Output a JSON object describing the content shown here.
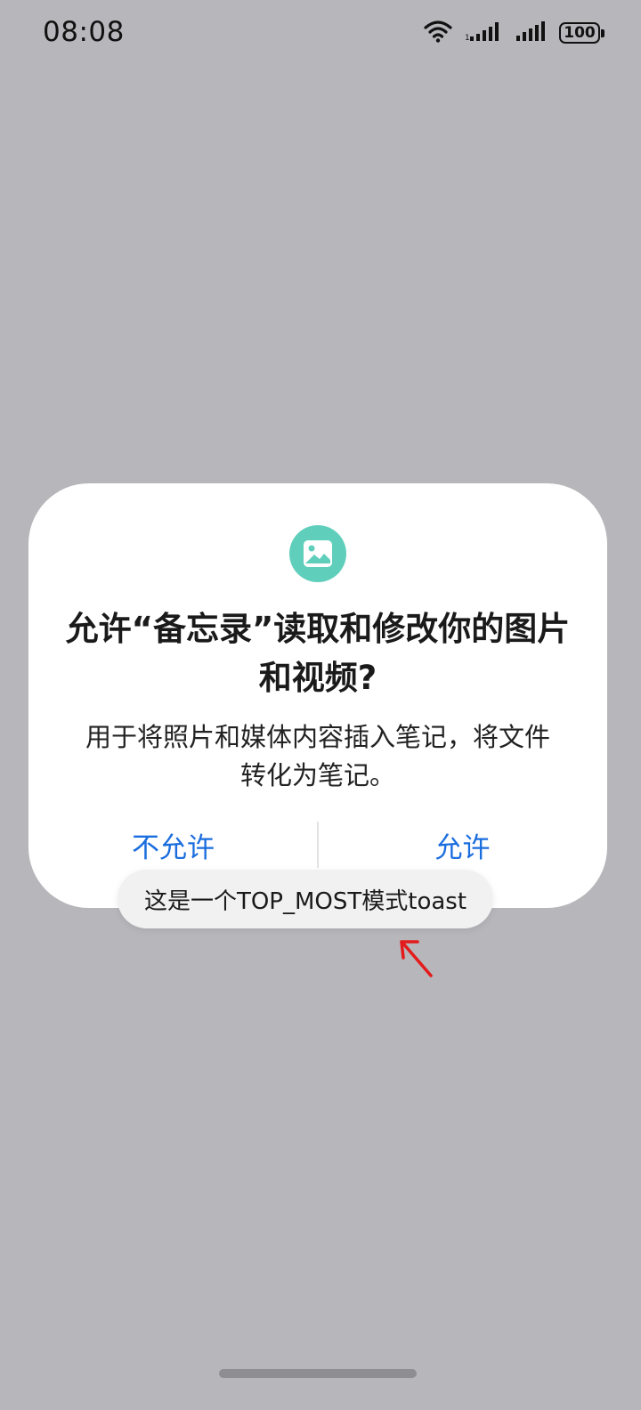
{
  "status_bar": {
    "time": "08:08",
    "battery": "100",
    "icons": [
      "wifi-icon",
      "signal-icon-sim1",
      "signal-icon-sim2",
      "battery-icon"
    ]
  },
  "dialog": {
    "icon": "image-icon",
    "icon_color": "#5fcfbb",
    "title": "允许“备忘录”读取和修改你的图片和视频?",
    "message": "用于将照片和媒体内容插入笔记，将文件转化为笔记。",
    "deny_label": "不允许",
    "allow_label": "允许",
    "button_color": "#1a6dde"
  },
  "toast": {
    "text": "这是一个TOP_MOST模式toast"
  },
  "annotation": {
    "icon": "red-arrow-icon",
    "color": "#e31b1b"
  }
}
